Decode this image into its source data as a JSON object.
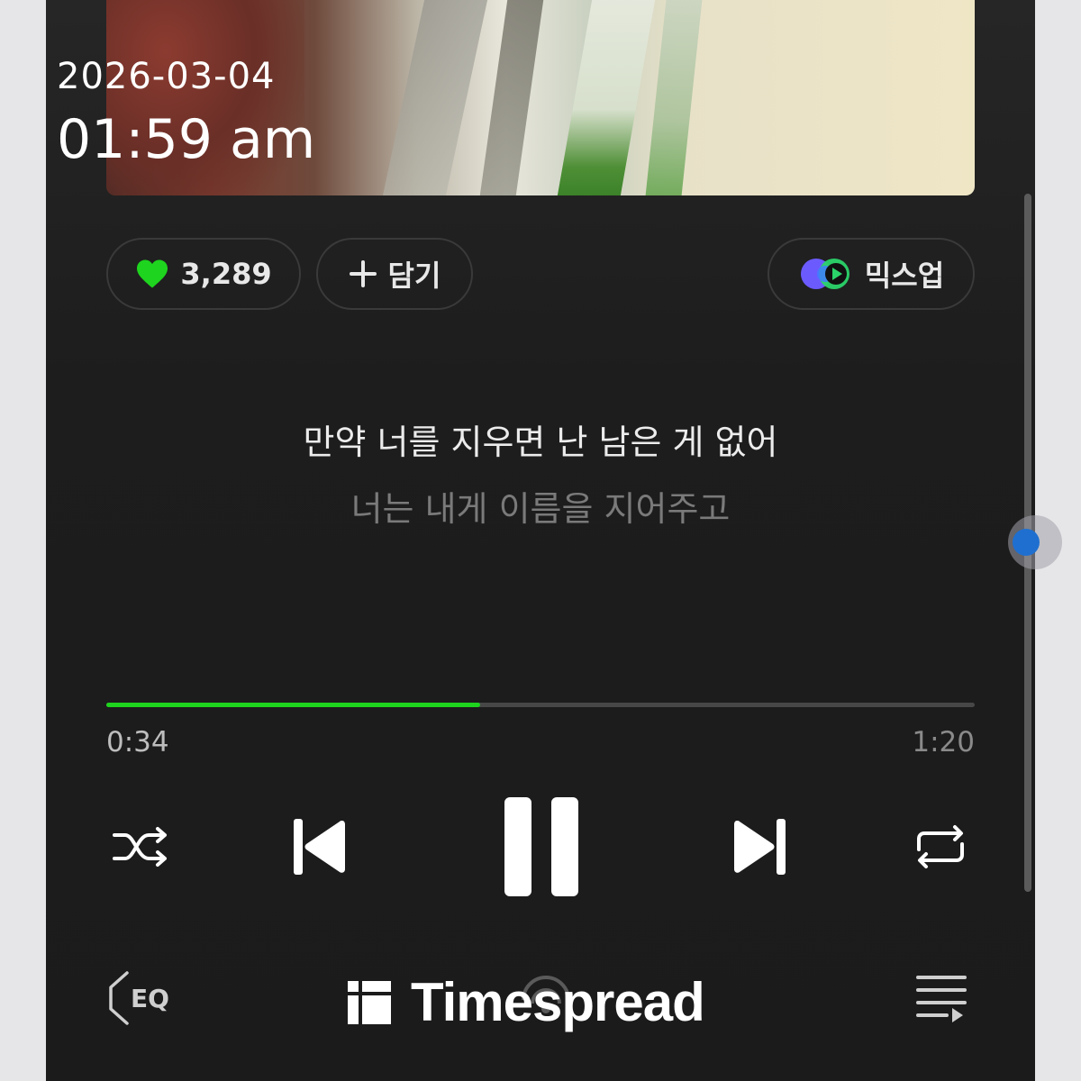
{
  "overlay": {
    "date": "2026-03-04",
    "time": "01:59 am"
  },
  "actions": {
    "like_count": "3,289",
    "add_label": "담기",
    "mixup_label": "믹스업"
  },
  "lyrics": {
    "current": "만약 너를 지우면 난 남은 게 없어",
    "next": "너는 내게 이름을 지어주고"
  },
  "playback": {
    "elapsed": "0:34",
    "total": "1:20",
    "progress_fraction": 0.43,
    "state": "playing"
  },
  "bottom": {
    "eq_label": "EQ",
    "watermark": "Timespread"
  },
  "colors": {
    "accent_green": "#1ed41e",
    "background": "#1d1d1d",
    "scroll_dot": "#1f6fd0"
  },
  "icons": [
    "heart-icon",
    "plus-icon",
    "mixup-icon",
    "shuffle-icon",
    "previous-icon",
    "pause-icon",
    "next-icon",
    "repeat-icon",
    "eq-icon",
    "cast-icon",
    "queue-icon"
  ]
}
